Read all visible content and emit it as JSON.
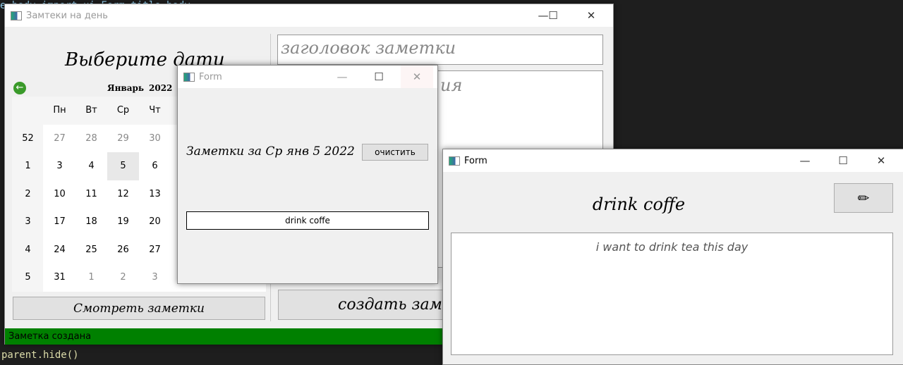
{
  "editor": {
    "top_code": "e body  import  ui  Form  title  body",
    "bottom_code": "parent.hide()"
  },
  "main": {
    "title": "Замтеки на день",
    "heading": "Выберите даmu",
    "calendar": {
      "month": "Январь",
      "year": "2022",
      "weekdays": [
        "Пн",
        "Вт",
        "Ср",
        "Чт"
      ],
      "rows": [
        {
          "week": "52",
          "days": [
            "27",
            "28",
            "29",
            "30"
          ],
          "gray": [
            true,
            true,
            true,
            true
          ]
        },
        {
          "week": "1",
          "days": [
            "3",
            "4",
            "5",
            "6"
          ],
          "gray": [
            false,
            false,
            false,
            false
          ]
        },
        {
          "week": "2",
          "days": [
            "10",
            "11",
            "12",
            "13"
          ],
          "gray": [
            false,
            false,
            false,
            false
          ]
        },
        {
          "week": "3",
          "days": [
            "17",
            "18",
            "19",
            "20"
          ],
          "gray": [
            false,
            false,
            false,
            false
          ]
        },
        {
          "week": "4",
          "days": [
            "24",
            "25",
            "26",
            "27"
          ],
          "gray": [
            false,
            false,
            false,
            false
          ]
        },
        {
          "week": "5",
          "days": [
            "31",
            "1",
            "2",
            "3"
          ],
          "gray": [
            false,
            true,
            true,
            true
          ]
        }
      ],
      "selected": "5"
    },
    "title_placeholder": "заголовок заметки",
    "body_placeholder_visible": "ия",
    "view_button": "Смотреть заметки",
    "create_button": "создать заме",
    "status": "Заметка создана",
    "status_color": "#008000"
  },
  "form1": {
    "title": "Form",
    "label": "Заметки за Ср янв 5 2022",
    "clear_button": "очистить",
    "note_item": "drink coffe"
  },
  "form2": {
    "title": "Form",
    "note_title": "drink coffe",
    "edit_icon": "pencil-icon",
    "note_body": "i want to drink tea this day"
  }
}
